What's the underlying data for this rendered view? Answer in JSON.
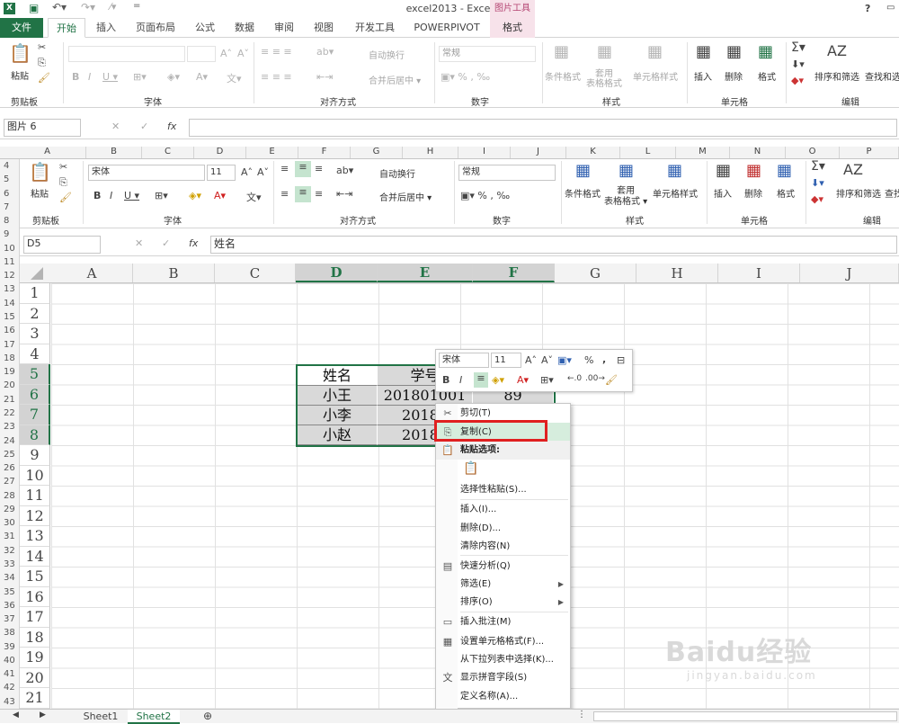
{
  "titlebar": {
    "title": "excel2013 - Excel",
    "picture_tools": "图片工具",
    "help": "?"
  },
  "tabs": [
    "文件",
    "开始",
    "插入",
    "页面布局",
    "公式",
    "数据",
    "审阅",
    "视图",
    "开发工具",
    "POWERPIVOT",
    "格式"
  ],
  "ribbon_top": {
    "paste": "粘贴",
    "font_name": "",
    "font_size": "",
    "wrap": "自动换行",
    "merge": "合并后居中 ▾",
    "numfmt": "常规",
    "cond_fmt": "条件格式",
    "table_fmt": "套用\n表格格式",
    "cell_style": "单元格样式",
    "insert": "插入",
    "delete": "删除",
    "format": "格式",
    "sort": "排序和筛选",
    "find": "查找和选",
    "groups": [
      "剪贴板",
      "字体",
      "对齐方式",
      "数字",
      "样式",
      "单元格",
      "编辑"
    ]
  },
  "formula_top": {
    "namebox": "图片 6",
    "fx": "fx"
  },
  "top_cols": [
    "A",
    "B",
    "C",
    "D",
    "E",
    "F",
    "G",
    "H",
    "I",
    "J",
    "K",
    "L",
    "M",
    "N",
    "O",
    "P"
  ],
  "ribbon_mid": {
    "paste": "粘贴",
    "font_name": "宋体",
    "font_size": "11",
    "wrap": "自动换行",
    "merge": "合并后居中 ▾",
    "numfmt": "常规",
    "cond_fmt": "条件格式",
    "table_fmt": "套用\n表格格式 ▾",
    "cell_style": "单元格样式",
    "insert": "插入",
    "delete": "删除",
    "format": "格式",
    "sort": "排序和筛选",
    "find": "查找",
    "groups": [
      "剪贴板",
      "字体",
      "对齐方式",
      "数字",
      "样式",
      "单元格",
      "编辑"
    ]
  },
  "formula": {
    "namebox": "D5",
    "fx": "fx",
    "value": "姓名"
  },
  "columns": [
    "A",
    "B",
    "C",
    "D",
    "E",
    "F",
    "G",
    "H",
    "I",
    "J"
  ],
  "left_rows": [
    "4",
    "5",
    "6",
    "7",
    "8",
    "9",
    "10",
    "11",
    "12",
    "13",
    "14",
    "15",
    "16",
    "17",
    "18",
    "19",
    "20",
    "21",
    "22",
    "23",
    "24",
    "25",
    "26",
    "27",
    "28",
    "29",
    "30",
    "31",
    "32",
    "33",
    "34",
    "35",
    "36",
    "37",
    "38",
    "39",
    "40",
    "41",
    "42",
    "43"
  ],
  "rows": [
    "1",
    "2",
    "3",
    "4",
    "5",
    "6",
    "7",
    "8",
    "9",
    "10",
    "11",
    "12",
    "13",
    "14",
    "15",
    "16",
    "17",
    "18",
    "19",
    "20",
    "21"
  ],
  "table": [
    [
      "姓名",
      "学号",
      ""
    ],
    [
      "小王",
      "201801001",
      "89"
    ],
    [
      "小李",
      "20180",
      ""
    ],
    [
      "小赵",
      "20180",
      ""
    ]
  ],
  "mini_toolbar": {
    "font": "宋体",
    "size": "11",
    "bold": "B",
    "italic": "I",
    "percent": "%",
    "comma": ","
  },
  "context_menu": [
    {
      "label": "剪切(T)",
      "icon": "✂"
    },
    {
      "label": "复制(C)",
      "icon": "⎘",
      "highlighted": true
    },
    {
      "label": "粘贴选项:",
      "icon": "📋",
      "header": true
    },
    {
      "label": "",
      "icon": "📋"
    },
    {
      "label": "选择性粘贴(S)...",
      "icon": ""
    },
    {
      "label": "插入(I)...",
      "icon": ""
    },
    {
      "label": "删除(D)...",
      "icon": ""
    },
    {
      "label": "清除内容(N)",
      "icon": ""
    },
    {
      "label": "快速分析(Q)",
      "icon": "▤"
    },
    {
      "label": "筛选(E)",
      "icon": "",
      "submenu": true
    },
    {
      "label": "排序(O)",
      "icon": "",
      "submenu": true
    },
    {
      "label": "插入批注(M)",
      "icon": "▭"
    },
    {
      "label": "设置单元格格式(F)...",
      "icon": "▦"
    },
    {
      "label": "从下拉列表中选择(K)...",
      "icon": ""
    },
    {
      "label": "显示拼音字段(S)",
      "icon": "文"
    },
    {
      "label": "定义名称(A)...",
      "icon": ""
    }
  ],
  "sheets": [
    "Sheet1",
    "Sheet2"
  ],
  "active_sheet": "Sheet2",
  "watermark": "Baidu经验",
  "watermark_url": "jingyan.baidu.com",
  "colors": {
    "excel_green": "#217346",
    "highlight_red": "#e02020",
    "selection_gray": "#d9d9d9"
  }
}
